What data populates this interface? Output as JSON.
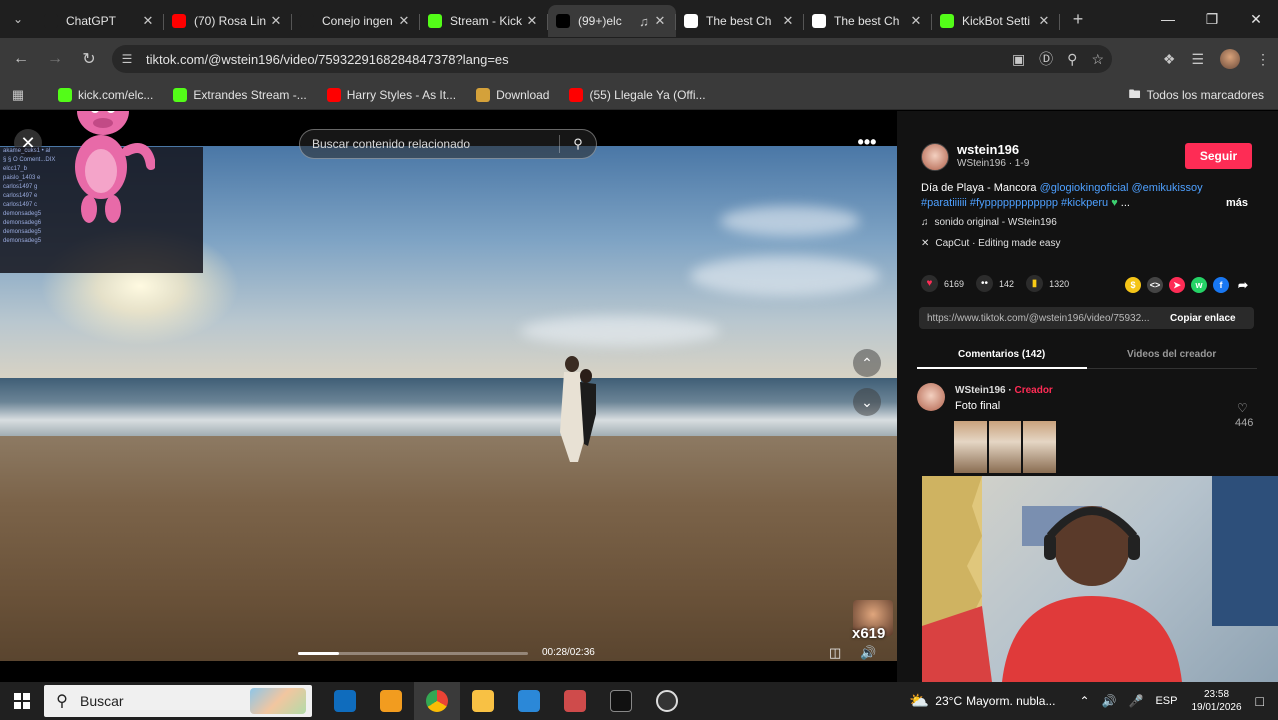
{
  "browser": {
    "tabs": [
      {
        "label": "ChatGPT",
        "icon": "chatgpt-icon",
        "color": "#1f1f1f",
        "active": false
      },
      {
        "label": "(70) Rosa Lin",
        "icon": "youtube-icon",
        "color": "#ff0000",
        "active": false
      },
      {
        "label": "Conejo ingen",
        "icon": "chatgpt-icon",
        "color": "#1f1f1f",
        "active": false
      },
      {
        "label": "Stream - Kick",
        "icon": "kick-icon",
        "color": "#53fc18",
        "active": false
      },
      {
        "label": "(99+)elc",
        "icon": "tiktok-icon",
        "color": "#000000",
        "active": true
      },
      {
        "label": "The best Ch",
        "icon": "diamond-icon",
        "color": "#ffffff",
        "active": false
      },
      {
        "label": "The best Ch",
        "icon": "diamond-icon",
        "color": "#ffffff",
        "active": false
      },
      {
        "label": "KickBot Setti",
        "icon": "kickbot-icon",
        "color": "#53fc18",
        "active": false
      }
    ],
    "url": "tiktok.com/@wstein196/video/7593229168284847378?lang=es",
    "bookmarks": [
      {
        "label": "kick.com/elc...",
        "color": "#53fc18",
        "icon": "kick-icon"
      },
      {
        "label": "Extrandes Stream -...",
        "color": "#53fc18",
        "icon": "kick-icon"
      },
      {
        "label": "Harry Styles - As It...",
        "color": "#ff0000",
        "icon": "youtube-icon"
      },
      {
        "label": "Download",
        "color": "#d4a13a",
        "icon": "download-site-icon"
      },
      {
        "label": "(55) Llegale Ya (Offi...",
        "color": "#ff0000",
        "icon": "youtube-icon"
      }
    ],
    "all_bookmarks": "Todos los marcadores"
  },
  "video": {
    "search_placeholder": "Buscar contenido relacionado",
    "time": "00:28/02:36",
    "progress": 0.18,
    "react_count": "x619"
  },
  "chat_lines": [
    "akame_cuks1 • al",
    "§ § O Coment...DIX",
    "",
    "",
    "elcc17_b",
    "paislo_1403 e",
    "",
    "carlos1497 g",
    "carlos1497 e",
    "carlos1497 c",
    "demonsadeg5",
    "demonsadeg6",
    "demonsadeg5",
    "demonsadeg5"
  ],
  "post": {
    "author": "wstein196",
    "author_sub": "WStein196 · 1-9",
    "follow": "Seguir",
    "desc_text": "Día de Playa - Mancora ",
    "desc_tags": "@glogiokingoficial @emikukissoy #paratiiiiii #fypppppppppppp #kickperu",
    "desc_more": "más",
    "sound": "sonido original - WStein196",
    "capcut": "CapCut · Editing made easy",
    "likes": "6169",
    "comments": "142",
    "saves": "1320",
    "link": "https://www.tiktok.com/@wstein196/video/75932...",
    "copy_link": "Copiar enlace",
    "tab_comments": "Comentarios (142)",
    "tab_videos": "Videos del creador",
    "comment_author": "WStein196",
    "comment_badge": "Creador",
    "comment_text": "Foto final",
    "comment_likes": "446"
  },
  "taskbar": {
    "search": "Buscar",
    "weather_temp": "23°C",
    "weather_text": "Mayorm. nubla...",
    "lang": "ESP",
    "time": "23:58",
    "date": "19/01/2026"
  }
}
